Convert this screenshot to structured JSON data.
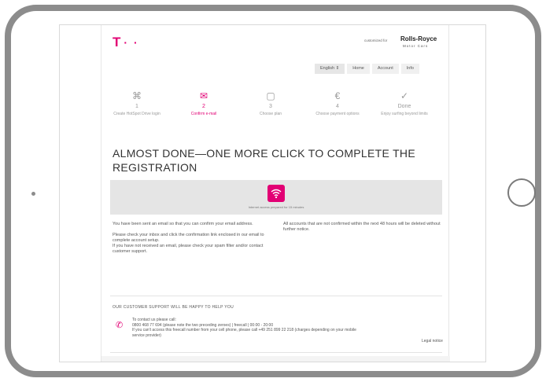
{
  "header": {
    "logo": "T",
    "logo_dots": "· ·",
    "customized_label": "customized for",
    "partner_name": "Rolls-Royce",
    "partner_sub": "Motor Cars"
  },
  "nav": {
    "language": "English ⇕",
    "home": "Home",
    "account": "Account",
    "info": "Info"
  },
  "steps": [
    {
      "icon": "tag-icon",
      "glyph": "⌘",
      "number": "1",
      "label": "Create HotSpot Drive login"
    },
    {
      "icon": "envelope-icon",
      "glyph": "✉",
      "number": "2",
      "label": "Confirm e-mail"
    },
    {
      "icon": "calendar-icon",
      "glyph": "▢",
      "number": "3",
      "label": "Choose plan"
    },
    {
      "icon": "euro-icon",
      "glyph": "€",
      "number": "4",
      "label": "Choose payment options"
    },
    {
      "icon": "check-icon",
      "glyph": "✓",
      "number": "Done",
      "label": "Enjoy surfing beyond limits"
    }
  ],
  "heading": "ALMOST DONE—ONE MORE CLICK TO COMPLETE THE REGISTRATION",
  "banner": {
    "icon": "wifi-icon",
    "text": "Internet access prepared for 15 minutes"
  },
  "info_left": [
    "You have been sent an email so that you can confirm your email address.",
    "Please check your inbox and click the confirmation link enclosed in our email to complete account setup.",
    "If you have not received an email, please check your spam filter and/or contact customer support."
  ],
  "info_right": "All accounts that are not confirmed within the next 48 hours will be deleted without further notice.",
  "support": {
    "heading": "OUR CUSTOMER SUPPORT WILL BE HAPPY TO HELP YOU",
    "line1": "To contact us please call:",
    "line2": "0800 468 77 694 (please note the two preceding zeroes) | freecall | 00:00 - 20:00",
    "line3": "If you can't access this freecall number from your cell phone, please call +49 251 899 22 218 (charges depending on your mobile service provider)"
  },
  "legal_notice": "Legal notice",
  "colors": {
    "brand": "#e20074",
    "frame": "#8c8c8c"
  }
}
